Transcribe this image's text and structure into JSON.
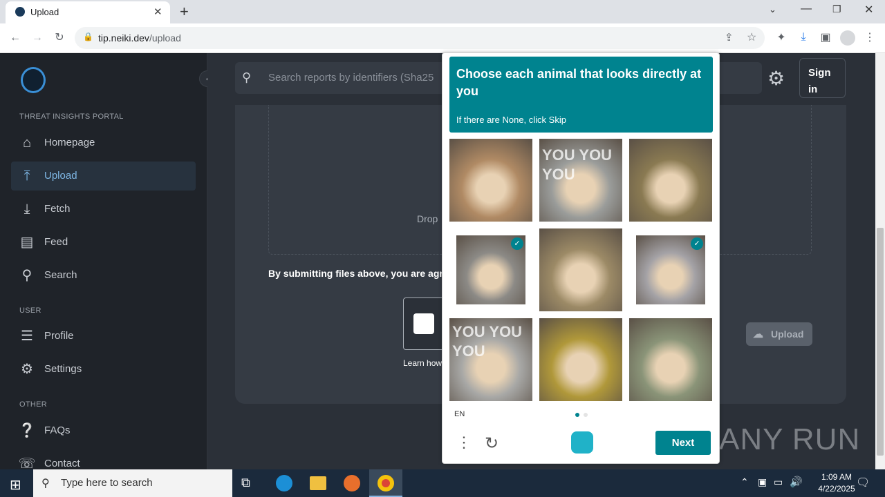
{
  "browser": {
    "tab_title": "Upload",
    "url_host": "tip.neiki.dev",
    "url_path": "/upload"
  },
  "sidebar": {
    "section_portal": "THREAT INSIGHTS PORTAL",
    "section_user": "USER",
    "section_other": "OTHER",
    "items": [
      {
        "label": "Homepage",
        "icon": "home-icon"
      },
      {
        "label": "Upload",
        "icon": "upload-icon"
      },
      {
        "label": "Fetch",
        "icon": "fetch-icon"
      },
      {
        "label": "Feed",
        "icon": "feed-icon"
      },
      {
        "label": "Search",
        "icon": "search-icon"
      },
      {
        "label": "Profile",
        "icon": "profile-icon"
      },
      {
        "label": "Settings",
        "icon": "gear-icon"
      },
      {
        "label": "FAQs",
        "icon": "faq-icon"
      },
      {
        "label": "Contact",
        "icon": "contact-icon"
      }
    ]
  },
  "header": {
    "search_placeholder": "Search reports by identifiers (Sha25",
    "sign_in_line1": "Sign",
    "sign_in_line2": "in"
  },
  "upload": {
    "drop_text": "Drop",
    "terms_text": "By submitting files above, you are agre",
    "learn_text": "Learn how",
    "upload_button": "Upload"
  },
  "captcha": {
    "prompt": "Choose each animal that looks directly at you",
    "hint": "If there are None, click Skip",
    "language": "EN",
    "next_button": "Next",
    "tiles": [
      {
        "selected": false,
        "color": "#b08a64"
      },
      {
        "selected": false,
        "color": "#9a9c9a"
      },
      {
        "selected": false,
        "color": "#8a7a52"
      },
      {
        "selected": true,
        "color": "#8c8a86"
      },
      {
        "selected": false,
        "color": "#9c8a66"
      },
      {
        "selected": true,
        "color": "#a4a2a6"
      },
      {
        "selected": false,
        "color": "#a8a8a6"
      },
      {
        "selected": false,
        "color": "#b0983a"
      },
      {
        "selected": false,
        "color": "#8a9478"
      }
    ],
    "tile_text_1": "YOU YOU YOU",
    "tile_text_6": "YOU YOU YOU"
  },
  "watermark": "ANY RUN",
  "taskbar": {
    "search_placeholder": "Type here to search",
    "time": "1:09 AM",
    "date": "4/22/2025"
  },
  "colors": {
    "accent": "#00838f",
    "sidebar_active": "#7fb8e6"
  }
}
